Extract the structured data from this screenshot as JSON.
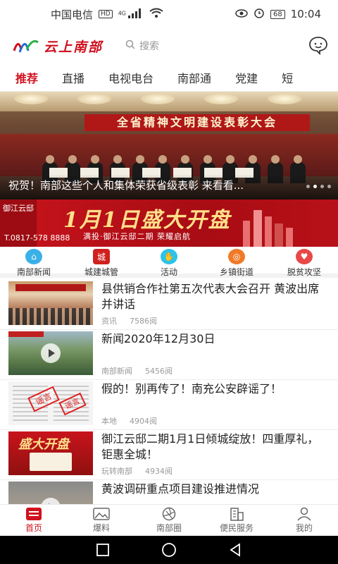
{
  "status_bar": {
    "carrier": "中国电信",
    "hd": "HD",
    "network": "4G",
    "battery": "68",
    "time": "10:04"
  },
  "header": {
    "logo_text": "云上南部",
    "search_placeholder": "搜索",
    "icons": {
      "search": "search-icon",
      "chat": "chat-bubble-icon"
    }
  },
  "tabs": [
    {
      "label": "推荐",
      "active": true
    },
    {
      "label": "直播"
    },
    {
      "label": "电视电台"
    },
    {
      "label": "南部通"
    },
    {
      "label": "党建"
    },
    {
      "label": "短"
    }
  ],
  "hero": {
    "banner_text": "全省精神文明建设表彰大会",
    "caption": "祝贺！南部这些个人和集体荣获省级表彰 来看看...",
    "slide_count": 4,
    "active_slide": 1
  },
  "ad": {
    "brand": "御江云邸",
    "headline": "1月1日盛大开盘",
    "subline": "满投·御江云邸二期 荣耀启航",
    "phone": "T.0817-578 8888"
  },
  "shortcuts": [
    {
      "label": "南部新闻",
      "icon": "home-icon",
      "color": "#3ab0e8"
    },
    {
      "label": "城建城管",
      "icon": "city-badge-icon",
      "color": "#d0201e"
    },
    {
      "label": "活动",
      "icon": "hand-icon",
      "color": "#2cc3e8"
    },
    {
      "label": "乡镇街道",
      "icon": "town-icon",
      "color": "#f07a28"
    },
    {
      "label": "脱贫攻坚",
      "icon": "handshake-icon",
      "color": "#e84848"
    }
  ],
  "news": [
    {
      "title": "县供销合作社第五次代表大会召开 黄波出席并讲话",
      "source": "资讯",
      "views": "7586阅",
      "video": false
    },
    {
      "title": "新闻2020年12月30日",
      "source": "南部新闻",
      "views": "5456阅",
      "video": true
    },
    {
      "title": "假的！别再传了！南充公安辟谣了！",
      "source": "本地",
      "views": "4904阅",
      "video": false
    },
    {
      "title": "御江云邸二期1月1日倾城绽放！四重厚礼，钜惠全城！",
      "source": "玩转南部",
      "views": "4934阅",
      "video": false
    },
    {
      "title": "黄波调研重点项目建设推进情况",
      "source": "",
      "views": "",
      "video": true
    }
  ],
  "bottom_nav": [
    {
      "label": "首页",
      "icon": "home-list-icon",
      "active": true
    },
    {
      "label": "爆料",
      "icon": "picture-icon"
    },
    {
      "label": "南部圈",
      "icon": "aperture-icon"
    },
    {
      "label": "便民服务",
      "icon": "building-icon"
    },
    {
      "label": "我的",
      "icon": "person-icon"
    }
  ],
  "colors": {
    "accent": "#d0101e",
    "muted": "#999999"
  }
}
